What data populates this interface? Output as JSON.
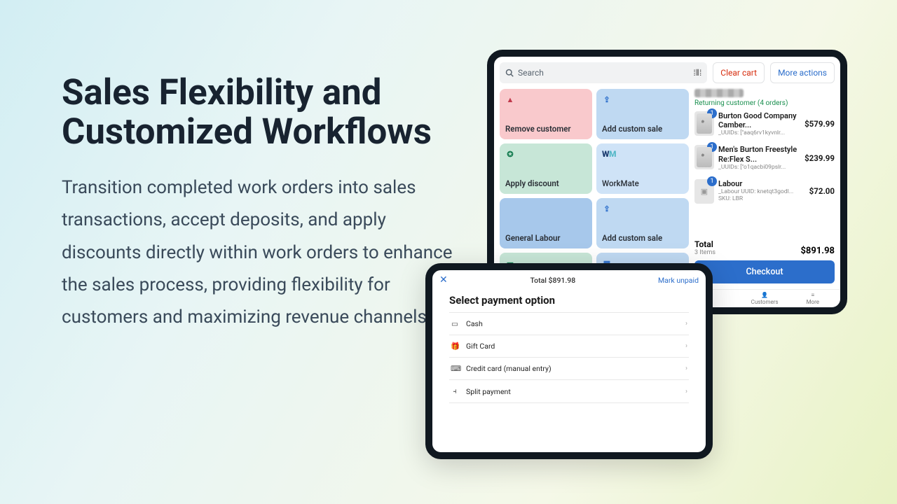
{
  "marketing": {
    "headline": "Sales Flexibility and Customized Workflows",
    "body": "Transition completed work orders into sales transactions, accept deposits, and apply discounts directly within work orders to enhance the sales process, providing flexibility for customers and maximizing revenue channels."
  },
  "pos": {
    "search_placeholder": "Search",
    "clear_cart": "Clear cart",
    "more_actions": "More actions",
    "tiles": [
      {
        "label": "Remove customer",
        "icon": "person-remove",
        "class": "t-pink"
      },
      {
        "label": "Add custom sale",
        "icon": "upload",
        "class": "t-blue"
      },
      {
        "label": "Apply discount",
        "icon": "discount",
        "class": "t-green"
      },
      {
        "label": "WorkMate",
        "icon": "workmate-logo",
        "class": "t-wm"
      },
      {
        "label": "General Labour",
        "icon": "",
        "class": "t-deepb"
      },
      {
        "label": "Add custom sale",
        "icon": "upload",
        "class": "t-blue"
      },
      {
        "label": "",
        "icon": "card",
        "class": "t-green"
      },
      {
        "label": "",
        "icon": "calendar",
        "class": "t-blue"
      }
    ],
    "customer_status": "Returning customer (4 orders)",
    "lines": [
      {
        "qty": "1",
        "name": "Burton Good Company Camber...",
        "sub": "_UUIDs: [\"aaq6rv1kyvnlr...",
        "price": "$579.99",
        "img": "snow"
      },
      {
        "qty": "1",
        "name": "Men's Burton Freestyle Re:Flex S...",
        "sub": "_UUIDs: [\"o1qacbi09pslr...",
        "price": "$239.99",
        "img": "snow"
      },
      {
        "qty": "1",
        "name": "Labour",
        "sub": "_Labour UUID: knetqt3godl...",
        "sub2": "SKU: LBR",
        "price": "$72.00",
        "img": "placeholder"
      }
    ],
    "total_label": "Total",
    "total_items": "3 Items",
    "total_value": "$891.98",
    "checkout": "Checkout",
    "tabbar": {
      "customers": "Customers",
      "more": "More"
    }
  },
  "payment": {
    "total": "Total $891.98",
    "mark_unpaid": "Mark unpaid",
    "title": "Select payment option",
    "options": [
      {
        "icon": "cash-icon",
        "label": "Cash"
      },
      {
        "icon": "gift-icon",
        "label": "Gift Card"
      },
      {
        "icon": "card-icon",
        "label": "Credit card (manual entry)"
      },
      {
        "icon": "split-icon",
        "label": "Split payment"
      }
    ]
  }
}
